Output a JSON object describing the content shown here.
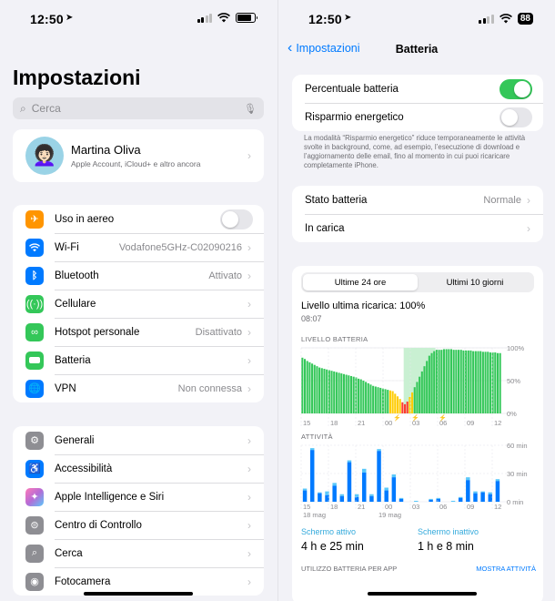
{
  "left": {
    "status": {
      "time": "12:50"
    },
    "title": "Impostazioni",
    "search": {
      "placeholder": "Cerca"
    },
    "profile": {
      "name": "Martina Oliva",
      "subtitle": "Apple Account, iCloud+ e altro ancora"
    },
    "group1": [
      {
        "label": "Uso in aereo",
        "value": "",
        "icon": "airplane-icon",
        "color": "#ff9500",
        "type": "toggle"
      },
      {
        "label": "Wi-Fi",
        "value": "Vodafone5GHz-C02090216",
        "icon": "wifi-icon",
        "color": "#007aff",
        "type": "link"
      },
      {
        "label": "Bluetooth",
        "value": "Attivato",
        "icon": "bluetooth-icon",
        "color": "#007aff",
        "type": "link"
      },
      {
        "label": "Cellulare",
        "value": "",
        "icon": "antenna-icon",
        "color": "#34c759",
        "type": "link"
      },
      {
        "label": "Hotspot personale",
        "value": "Disattivato",
        "icon": "hotspot-icon",
        "color": "#34c759",
        "type": "link"
      },
      {
        "label": "Batteria",
        "value": "",
        "icon": "battery-icon",
        "color": "#34c759",
        "type": "link"
      },
      {
        "label": "VPN",
        "value": "Non connessa",
        "icon": "globe-icon",
        "color": "#007aff",
        "type": "link"
      }
    ],
    "group2": [
      {
        "label": "Generali",
        "icon": "gear-icon",
        "color": "#8e8e93"
      },
      {
        "label": "Accessibilità",
        "icon": "accessibility-icon",
        "color": "#007aff"
      },
      {
        "label": "Apple Intelligence e Siri",
        "icon": "siri-icon",
        "color": "#b56bd6"
      },
      {
        "label": "Centro di Controllo",
        "icon": "control-center-icon",
        "color": "#8e8e93"
      },
      {
        "label": "Cerca",
        "icon": "search-icon",
        "color": "#8e8e93"
      },
      {
        "label": "Fotocamera",
        "icon": "camera-icon",
        "color": "#8e8e93"
      }
    ]
  },
  "right": {
    "status": {
      "time": "12:50",
      "battery": "88"
    },
    "nav": {
      "back": "Impostazioni",
      "title": "Batteria"
    },
    "toggles": [
      {
        "label": "Percentuale batteria",
        "on": true
      },
      {
        "label": "Risparmio energetico",
        "on": false
      }
    ],
    "footnote": "La modalità “Risparmio energetico” riduce temporaneamente le attività svolte in background, come, ad esempio, l’esecuzione di download e l’aggiornamento delle email, fino al momento in cui puoi ricaricare completamente iPhone.",
    "status_rows": [
      {
        "label": "Stato batteria",
        "value": "Normale"
      },
      {
        "label": "In carica",
        "value": ""
      }
    ],
    "segments": [
      "Ultime 24 ore",
      "Ultimi 10 giorni"
    ],
    "last_charge": "Livello ultima ricarica: 100%",
    "last_charge_time": "08:07",
    "usage": {
      "active_label": "Schermo attivo",
      "active_value": "4 h e 25 min",
      "inactive_label": "Schermo inattivo",
      "inactive_value": "1 h e 8 min"
    },
    "bottom": {
      "left": "UTILIZZO BATTERIA PER APP",
      "right": "MOSTRA ATTIVITÀ"
    }
  },
  "chart_data": [
    {
      "type": "bar",
      "title": "LIVELLO BATTERIA",
      "ylim": [
        0,
        100
      ],
      "y_ticks": [
        "100%",
        "50%",
        "0%"
      ],
      "x_ticks": [
        "15",
        "18",
        "21",
        "00",
        "03",
        "06",
        "09",
        "12"
      ],
      "colors": {
        "normal": "#34c759",
        "low": "#ffcc00",
        "critical": "#ff3b30",
        "charging_bg": "#c9f0d2"
      },
      "values": [
        85,
        83,
        80,
        78,
        76,
        74,
        72,
        70,
        69,
        68,
        67,
        66,
        65,
        64,
        63,
        62,
        61,
        60,
        59,
        58,
        57,
        56,
        55,
        53,
        52,
        50,
        48,
        46,
        44,
        42,
        41,
        40,
        39,
        38,
        37,
        36,
        35,
        34,
        30,
        26,
        22,
        17,
        14,
        18,
        25,
        32,
        40,
        48,
        56,
        64,
        72,
        80,
        88,
        92,
        95,
        97,
        97,
        97,
        98,
        98,
        98,
        98,
        97,
        97,
        97,
        97,
        96,
        96,
        96,
        96,
        95,
        95,
        95,
        95,
        94,
        94,
        94,
        93,
        93,
        93,
        92,
        92
      ]
    },
    {
      "type": "bar",
      "title": "ATTIVITÀ",
      "ylim": [
        0,
        60
      ],
      "y_ticks": [
        "60 min",
        "30 min",
        "0 min"
      ],
      "x_ticks": [
        "15",
        "18",
        "21",
        "00",
        "03",
        "06",
        "09",
        "12"
      ],
      "date_labels": [
        "18 mag",
        "19 mag"
      ],
      "series": [
        {
          "name": "Schermo attivo",
          "color": "#007aff",
          "values": [
            12,
            55,
            9,
            7,
            17,
            6,
            42,
            5,
            31,
            6,
            54,
            12,
            26,
            3,
            0,
            0,
            0,
            2,
            3,
            0,
            0,
            4,
            23,
            9,
            10,
            8,
            22
          ]
        },
        {
          "name": "Schermo inattivo",
          "color": "#5ac8fa",
          "values": [
            2,
            2,
            1,
            4,
            3,
            2,
            2,
            3,
            4,
            2,
            2,
            3,
            3,
            1,
            0,
            1,
            0,
            1,
            1,
            0,
            1,
            1,
            3,
            2,
            1,
            2,
            2
          ]
        }
      ]
    }
  ]
}
